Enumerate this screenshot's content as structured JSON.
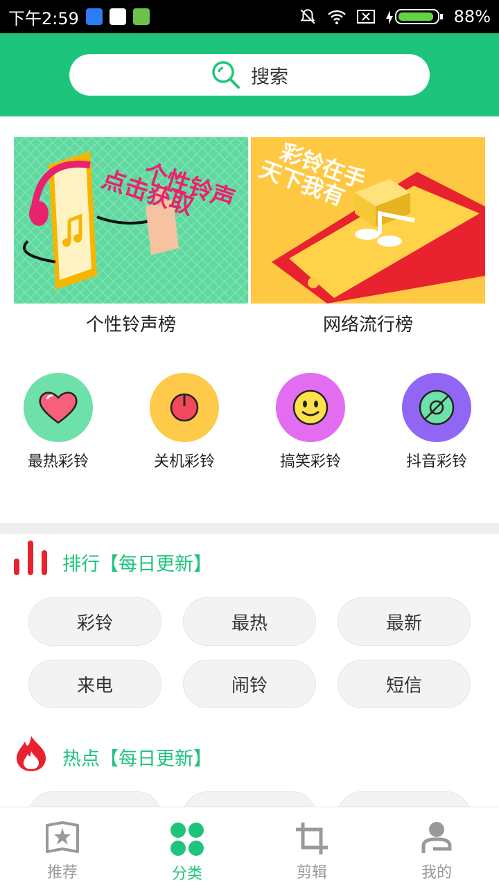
{
  "status_bar": {
    "time": "下午2:59",
    "battery": "88%"
  },
  "search": {
    "label": "搜索"
  },
  "banners": [
    {
      "label": "个性铃声榜"
    },
    {
      "label": "网络流行榜"
    }
  ],
  "categories": [
    {
      "label": "最热彩铃",
      "icon": "heart-icon",
      "color": "#6ee0aa"
    },
    {
      "label": "关机彩铃",
      "icon": "power-icon",
      "color": "#ffc94a"
    },
    {
      "label": "搞笑彩铃",
      "icon": "smiley-icon",
      "color": "#e26df0"
    },
    {
      "label": "抖音彩铃",
      "icon": "disc-icon",
      "color": "#9166f5"
    }
  ],
  "sections": {
    "ranking": {
      "title": "排行【每日更新】",
      "tags": [
        "彩铃",
        "最热",
        "最新",
        "来电",
        "闹铃",
        "短信"
      ]
    },
    "hot": {
      "title": "热点【每日更新】"
    }
  },
  "bottom_nav": [
    {
      "label": "推荐",
      "icon": "star-book-icon",
      "active": false
    },
    {
      "label": "分类",
      "icon": "clover-icon",
      "active": true
    },
    {
      "label": "剪辑",
      "icon": "crop-icon",
      "active": false
    },
    {
      "label": "我的",
      "icon": "user-icon",
      "active": false
    }
  ],
  "colors": {
    "brand": "#1ec47c",
    "accent_red": "#e8222e"
  }
}
